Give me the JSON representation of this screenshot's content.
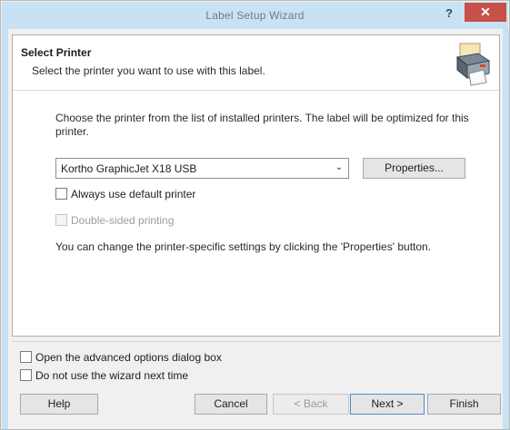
{
  "window": {
    "title": "Label Setup Wizard",
    "help_glyph": "?",
    "close_glyph": "✕"
  },
  "header": {
    "title": "Select Printer",
    "subtitle": "Select the printer you want to use with this label.",
    "icon": "printer-icon"
  },
  "body": {
    "description": "Choose the printer from the list of installed printers. The label will be optimized for this printer.",
    "printer_select": {
      "selected": "Kortho GraphicJet X18 USB",
      "dropdown_glyph": "⌄"
    },
    "properties_button": "Properties...",
    "always_default": {
      "label": "Always use default printer",
      "checked": false
    },
    "double_sided": {
      "label": "Double-sided printing",
      "checked": false,
      "enabled": false
    },
    "note": "You can change the printer-specific settings by clicking the 'Properties' button."
  },
  "footer": {
    "advanced_options": {
      "label": "Open the advanced options dialog box",
      "checked": false
    },
    "no_wizard": {
      "label": "Do not use the wizard next time",
      "checked": false
    },
    "buttons": {
      "help": "Help",
      "cancel": "Cancel",
      "back": "< Back",
      "next": "Next >",
      "finish": "Finish"
    }
  },
  "colors": {
    "titlebar": "#c8e2f4",
    "close": "#c7504b",
    "panel": "#ffffff",
    "dialog": "#f0f0f0"
  }
}
